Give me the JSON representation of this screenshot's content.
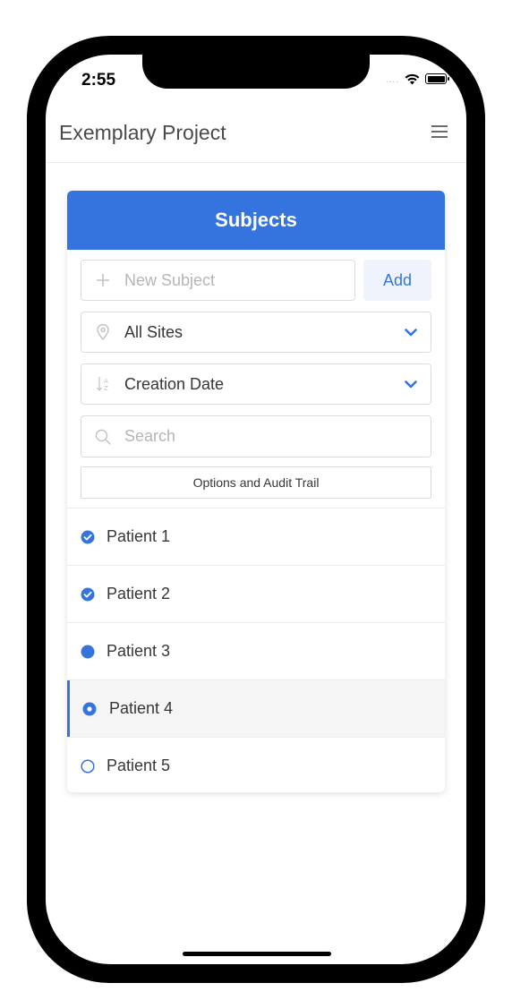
{
  "status_bar": {
    "time": "2:55",
    "signal": "....",
    "icons": [
      "wifi-icon",
      "battery-icon"
    ]
  },
  "header": {
    "title": "Exemplary Project",
    "menu_icon": "hamburger-menu-icon"
  },
  "card": {
    "title": "Subjects",
    "new_subject": {
      "placeholder": "New Subject",
      "icon": "plus-icon"
    },
    "add_label": "Add",
    "site_filter": {
      "value": "All Sites",
      "icon": "location-pin-icon"
    },
    "sort": {
      "value": "Creation Date",
      "icon": "sort-icon"
    },
    "search": {
      "placeholder": "Search",
      "icon": "search-icon"
    },
    "options_label": "Options and Audit Trail",
    "patients": [
      {
        "label": "Patient 1",
        "status": "completed",
        "icon": "check-circle-icon"
      },
      {
        "label": "Patient 2",
        "status": "completed",
        "icon": "check-circle-icon"
      },
      {
        "label": "Patient 3",
        "status": "filled",
        "icon": "filled-circle-icon"
      },
      {
        "label": "Patient 4",
        "status": "selected",
        "icon": "dot-circle-icon"
      },
      {
        "label": "Patient 5",
        "status": "empty",
        "icon": "empty-circle-icon"
      }
    ]
  },
  "colors": {
    "accent": "#3574de",
    "add_bg": "#eef3fc",
    "text": "#363636",
    "selected_bg": "#f5f5f5"
  }
}
